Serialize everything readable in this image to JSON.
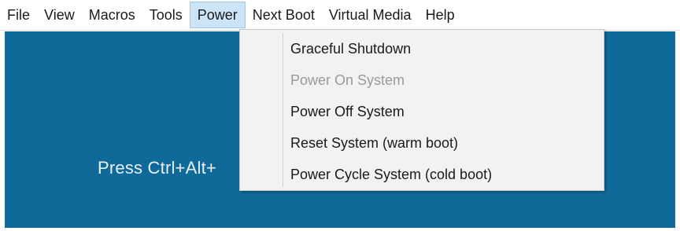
{
  "menubar": {
    "items": [
      {
        "label": "File"
      },
      {
        "label": "View"
      },
      {
        "label": "Macros"
      },
      {
        "label": "Tools"
      },
      {
        "label": "Power"
      },
      {
        "label": "Next Boot"
      },
      {
        "label": "Virtual Media"
      },
      {
        "label": "Help"
      }
    ]
  },
  "console": {
    "message": "Press Ctrl+Alt+"
  },
  "power_menu": {
    "items": [
      {
        "label": "Graceful Shutdown",
        "enabled": true
      },
      {
        "label": "Power On System",
        "enabled": false
      },
      {
        "label": "Power Off System",
        "enabled": true
      },
      {
        "label": "Reset System (warm boot)",
        "enabled": true
      },
      {
        "label": "Power Cycle System (cold boot)",
        "enabled": true
      }
    ]
  },
  "colors": {
    "console_background": "#0f6a99",
    "active_menu_highlight": "#cce4f7",
    "disabled_text": "#9a9a9a"
  }
}
